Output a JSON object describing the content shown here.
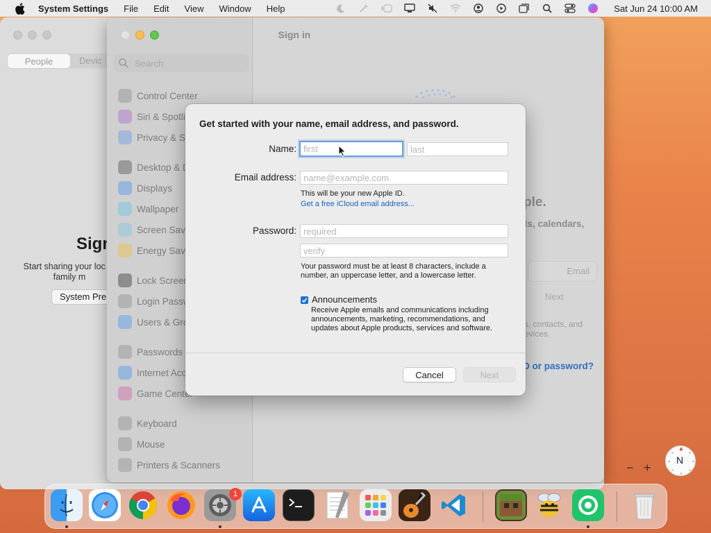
{
  "menubar": {
    "app_name": "System Settings",
    "menus": [
      "File",
      "Edit",
      "View",
      "Window",
      "Help"
    ],
    "clock": "Sat Jun 24  10:00 AM"
  },
  "bg_window": {
    "segment_active": "People",
    "segment_inactive": "Devic",
    "title": "Sign",
    "text": "Start sharing your loc or family m",
    "button": "System Pre"
  },
  "settings_window": {
    "title": "Sign in",
    "search_placeholder": "Search",
    "sidebar": [
      {
        "label": "Control Center",
        "icon": "control-center-icon",
        "color": "#9a9a9a"
      },
      {
        "label": "Siri & Spotli",
        "icon": "siri-icon",
        "color": "#b07fd0"
      },
      {
        "label": "Privacy & S",
        "icon": "hand-icon",
        "color": "#7fa6e0"
      },
      {
        "label": "Desktop & D",
        "icon": "desktop-icon",
        "color": "#6e6e6e"
      },
      {
        "label": "Displays",
        "icon": "displays-icon",
        "color": "#6aa3e8"
      },
      {
        "label": "Wallpaper",
        "icon": "wallpaper-icon",
        "color": "#7ec4e0"
      },
      {
        "label": "Screen Save",
        "icon": "screen-saver-icon",
        "color": "#8fc7d8"
      },
      {
        "label": "Energy Save",
        "icon": "energy-icon",
        "color": "#e8c25a"
      },
      {
        "label": "Lock Screen",
        "icon": "lock-icon",
        "color": "#555555"
      },
      {
        "label": "Login Passw",
        "icon": "login-password-icon",
        "color": "#9a9a9a"
      },
      {
        "label": "Users & Gro",
        "icon": "users-icon",
        "color": "#6aa3e8"
      },
      {
        "label": "Passwords",
        "icon": "key-icon",
        "color": "#9a9a9a"
      },
      {
        "label": "Internet Acc",
        "icon": "at-icon",
        "color": "#6aa3e8"
      },
      {
        "label": "Game Center",
        "icon": "game-center-icon",
        "color": "#d07ab0"
      },
      {
        "label": "Keyboard",
        "icon": "keyboard-icon",
        "color": "#9a9a9a"
      },
      {
        "label": "Mouse",
        "icon": "mouse-icon",
        "color": "#9a9a9a"
      },
      {
        "label": "Printers & Scanners",
        "icon": "printer-icon",
        "color": "#9a9a9a"
      }
    ],
    "main_fragments": {
      "ple": "ple.",
      "calendars": "ts, calendars,",
      "email": "Email",
      "next": "Next",
      "contacts": "s, contacts, and",
      "devices": "evices.",
      "link": "D or password?"
    }
  },
  "dialog": {
    "heading": "Get started with your name, email address, and password.",
    "name_label": "Name:",
    "first_placeholder": "first",
    "last_placeholder": "last",
    "email_label": "Email address:",
    "email_placeholder": "name@example.com",
    "apple_id_note": "This will be your new Apple ID.",
    "icloud_link": "Get a free iCloud email address...",
    "password_label": "Password:",
    "password_placeholder": "required",
    "verify_placeholder": "verify",
    "password_note_1": "Your password must be at least 8 characters, include a",
    "password_note_2": "number, an uppercase letter, and a lowercase letter.",
    "announcements_checked": true,
    "announcements_label": "Announcements",
    "announcements_note_1": "Receive Apple emails and communications including",
    "announcements_note_2": "announcements, marketing, recommendations, and",
    "announcements_note_3": "updates about Apple products, services and software.",
    "cancel": "Cancel",
    "next": "Next"
  },
  "map_controls": {
    "minus": "−",
    "plus": "+",
    "compass": "N"
  },
  "dock": {
    "settings_badge": "1",
    "apps": [
      {
        "name": "finder",
        "color": "#3d9bf0"
      },
      {
        "name": "safari",
        "color": "#2f8ff0"
      },
      {
        "name": "chrome",
        "color": "#ffffff"
      },
      {
        "name": "firefox",
        "color": "#ff7a1a"
      },
      {
        "name": "system-settings",
        "color": "#8a8a8a"
      },
      {
        "name": "app-store",
        "color": "#1e8ef5"
      },
      {
        "name": "terminal",
        "color": "#1e1e1e"
      },
      {
        "name": "textedit",
        "color": "#f5f5f5"
      },
      {
        "name": "launchpad",
        "color": "#e9e9e9"
      },
      {
        "name": "garageband",
        "color": "#e98a2d"
      },
      {
        "name": "vscode",
        "color": "#ffffff"
      },
      {
        "name": "minecraft",
        "color": "#6b8e3a"
      },
      {
        "name": "bee-app",
        "color": "#f1c232"
      },
      {
        "name": "green-app",
        "color": "#20c46b"
      },
      {
        "name": "trash",
        "color": "#e6e6e6"
      }
    ]
  }
}
